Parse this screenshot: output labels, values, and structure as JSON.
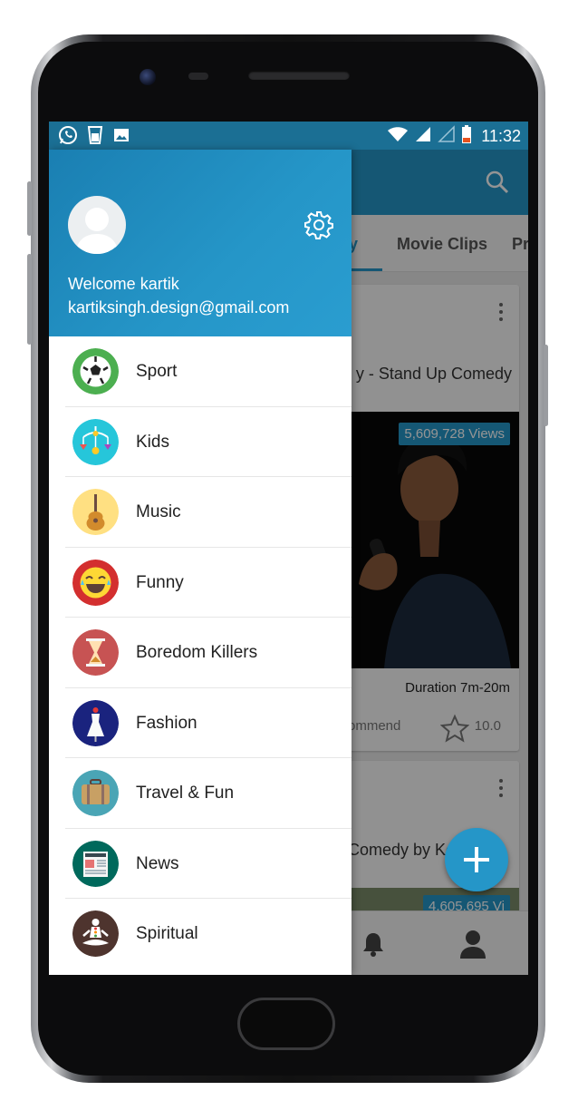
{
  "status_bar": {
    "time": "11:32",
    "left_icons": [
      "whatsapp-icon",
      "glass-icon",
      "image-icon"
    ],
    "right_icons": [
      "wifi-icon",
      "signal-icon",
      "signal-empty-icon",
      "battery-icon"
    ]
  },
  "drawer": {
    "welcome": "Welcome kartik",
    "email": "kartiksingh.design@gmail.com",
    "items": [
      {
        "label": "Sport",
        "icon": "soccer-ball-icon"
      },
      {
        "label": "Kids",
        "icon": "baby-mobile-icon"
      },
      {
        "label": "Music",
        "icon": "guitar-icon"
      },
      {
        "label": "Funny",
        "icon": "laughing-face-icon"
      },
      {
        "label": "Boredom Killers",
        "icon": "hourglass-icon"
      },
      {
        "label": "Fashion",
        "icon": "dress-mannequin-icon"
      },
      {
        "label": "Travel & Fun",
        "icon": "suitcase-icon"
      },
      {
        "label": "News",
        "icon": "newspaper-icon"
      },
      {
        "label": "Spiritual",
        "icon": "meditation-icon"
      }
    ]
  },
  "background_app": {
    "tabs": [
      "dy",
      "Movie Clips",
      "Pr"
    ],
    "cards": [
      {
        "title": "y - Stand Up Comedy",
        "views": "5,609,728 Views",
        "duration": "Duration 7m-20m",
        "recommend": "ommend",
        "rating": "10.0"
      },
      {
        "title": "Comedy by Ke",
        "views": "4,605,695 Vi"
      }
    ]
  },
  "colors": {
    "primary": "#2596c8",
    "status_bar": "#1b6f94",
    "drawer_bg": "#ffffff"
  }
}
